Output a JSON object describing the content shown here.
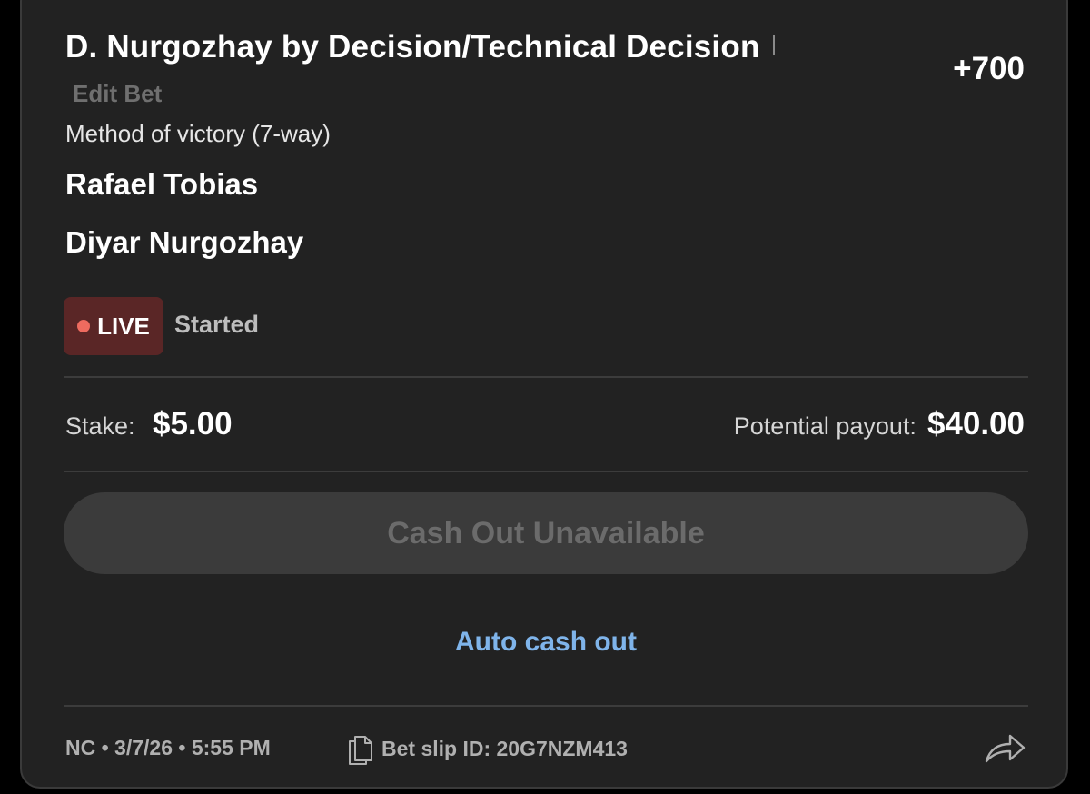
{
  "bet": {
    "title": "D. Nurgozhay by Decision/Technical Decision",
    "odds": "+700",
    "edit_label": "Edit Bet",
    "market": "Method of victory (7-way)",
    "team_one": "Rafael Tobias",
    "team_two": "Diyar Nurgozhay"
  },
  "status": {
    "live_label": "LIVE",
    "state": "Started",
    "live_color": "#5a2626",
    "dot_color": "#ee6b5f"
  },
  "wager": {
    "stake_label": "Stake:",
    "stake_value": "$5.00",
    "payout_label": "Potential payout:",
    "payout_value": "$40.00"
  },
  "actions": {
    "cashout_label": "Cash Out Unavailable",
    "auto_cashout_label": "Auto cash out"
  },
  "footer": {
    "meta": "NC • 3/7/26 • 5:55 PM",
    "slip_id": "Bet slip ID: 20G7NZM413",
    "slip_icon": "document-icon",
    "share_icon": "share-icon"
  },
  "colors": {
    "background": "#000000",
    "card": "#222222",
    "accent_link": "#7fb4ea"
  }
}
